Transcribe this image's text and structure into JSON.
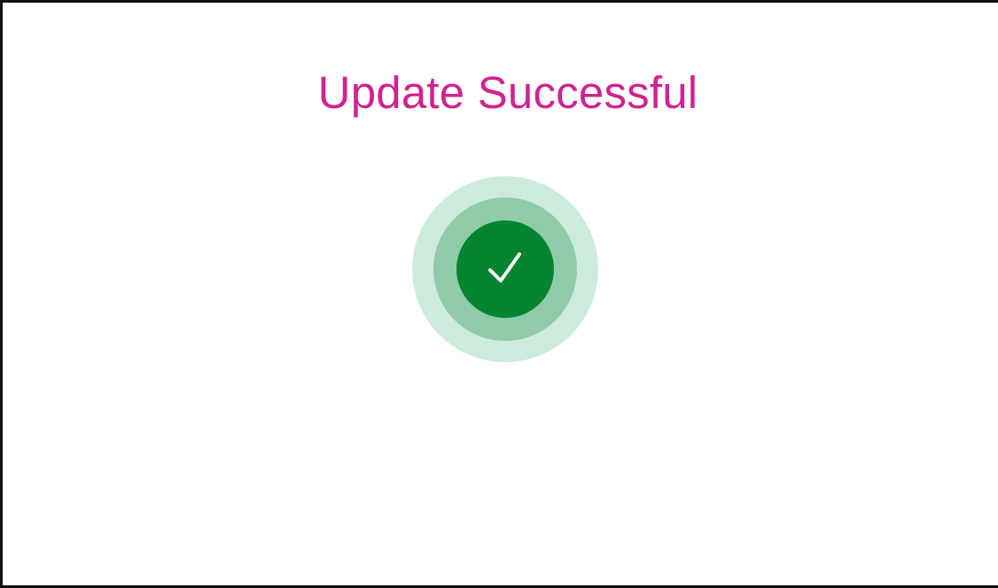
{
  "dialog": {
    "title": "Update Successful"
  },
  "icon": {
    "name": "check-icon",
    "status": "success"
  },
  "colors": {
    "title": "#D0238F",
    "outer_ring": "#CDEBDD",
    "middle_ring": "#8FCBA8",
    "inner_circle": "#05842F",
    "check": "#FFFFFF"
  }
}
